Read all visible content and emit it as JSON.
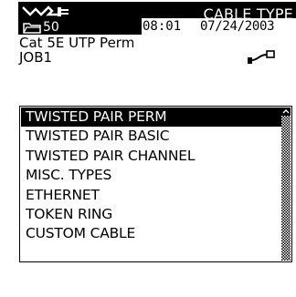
{
  "header": {
    "title": "CABLE TYPE",
    "folder_count": "50",
    "time": "08:01",
    "date": "07/24/2003"
  },
  "info": {
    "cable_name": "Cat 5E UTP Perm",
    "job_name": "JOB1"
  },
  "list": {
    "selected_index": 0,
    "items": [
      "TWISTED PAIR PERM",
      "TWISTED PAIR BASIC",
      "TWISTED PAIR CHANNEL",
      "MISC. TYPES",
      "ETHERNET",
      "TOKEN RING",
      "CUSTOM CABLE"
    ]
  },
  "icons": {
    "brand": "fluke-logo-icon",
    "folder": "folder-icon",
    "connector": "cable-connector-icon",
    "scroll_up": "scroll-up-arrow-icon"
  }
}
